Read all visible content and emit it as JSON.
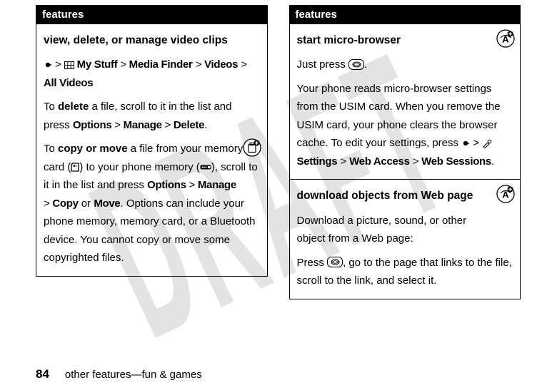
{
  "watermark": "DRAFT",
  "left": {
    "header": "features",
    "cell1": {
      "title": "view, delete, or manage video clips",
      "nav": {
        "sep": ">",
        "mystuff": "My Stuff",
        "mediafinder": "Media Finder",
        "videos": "Videos",
        "allvideos": "All Videos"
      },
      "p2a": "To ",
      "p2b": "delete",
      "p2c": " a file, scroll to it in the list and press ",
      "p2opt": "Options",
      "p2mng": "Manage",
      "p2del": "Delete",
      "p2dot": ".",
      "p3a": "To ",
      "p3b": "copy or move",
      "p3c": " a file from your memory card (",
      "p3d": ") to your phone memory (",
      "p3e": "), scroll to it in the list and press ",
      "p3opt": "Options",
      "p3mng": "Manage",
      "p3f": " > ",
      "p3copy": "Copy",
      "p3or": " or ",
      "p3move": "Move",
      "p3g": ". Options can include your phone memory, memory card, or a Bluetooth device. You cannot copy or move some copyrighted files."
    }
  },
  "right": {
    "header": "features",
    "cell1": {
      "title": "start micro-browser",
      "p1a": "Just press ",
      "p1b": ".",
      "p2a": "Your phone reads micro-browser settings from the USIM card. When you remove the USIM card, your phone clears the browser cache. To edit your settings, press ",
      "p2sep": ">",
      "p2set": "Settings",
      "p2wa": "Web Access",
      "p2ws": "Web Sessions",
      "p2dot": "."
    },
    "cell2": {
      "title": "download objects from Web page",
      "p1": "Download a picture, sound, or other object from a Web page:",
      "p2a": "Press ",
      "p2b": ", go to the page that links to the file, scroll to the link, and select it."
    }
  },
  "footer": {
    "page": "84",
    "text": "other features—fun & games"
  }
}
